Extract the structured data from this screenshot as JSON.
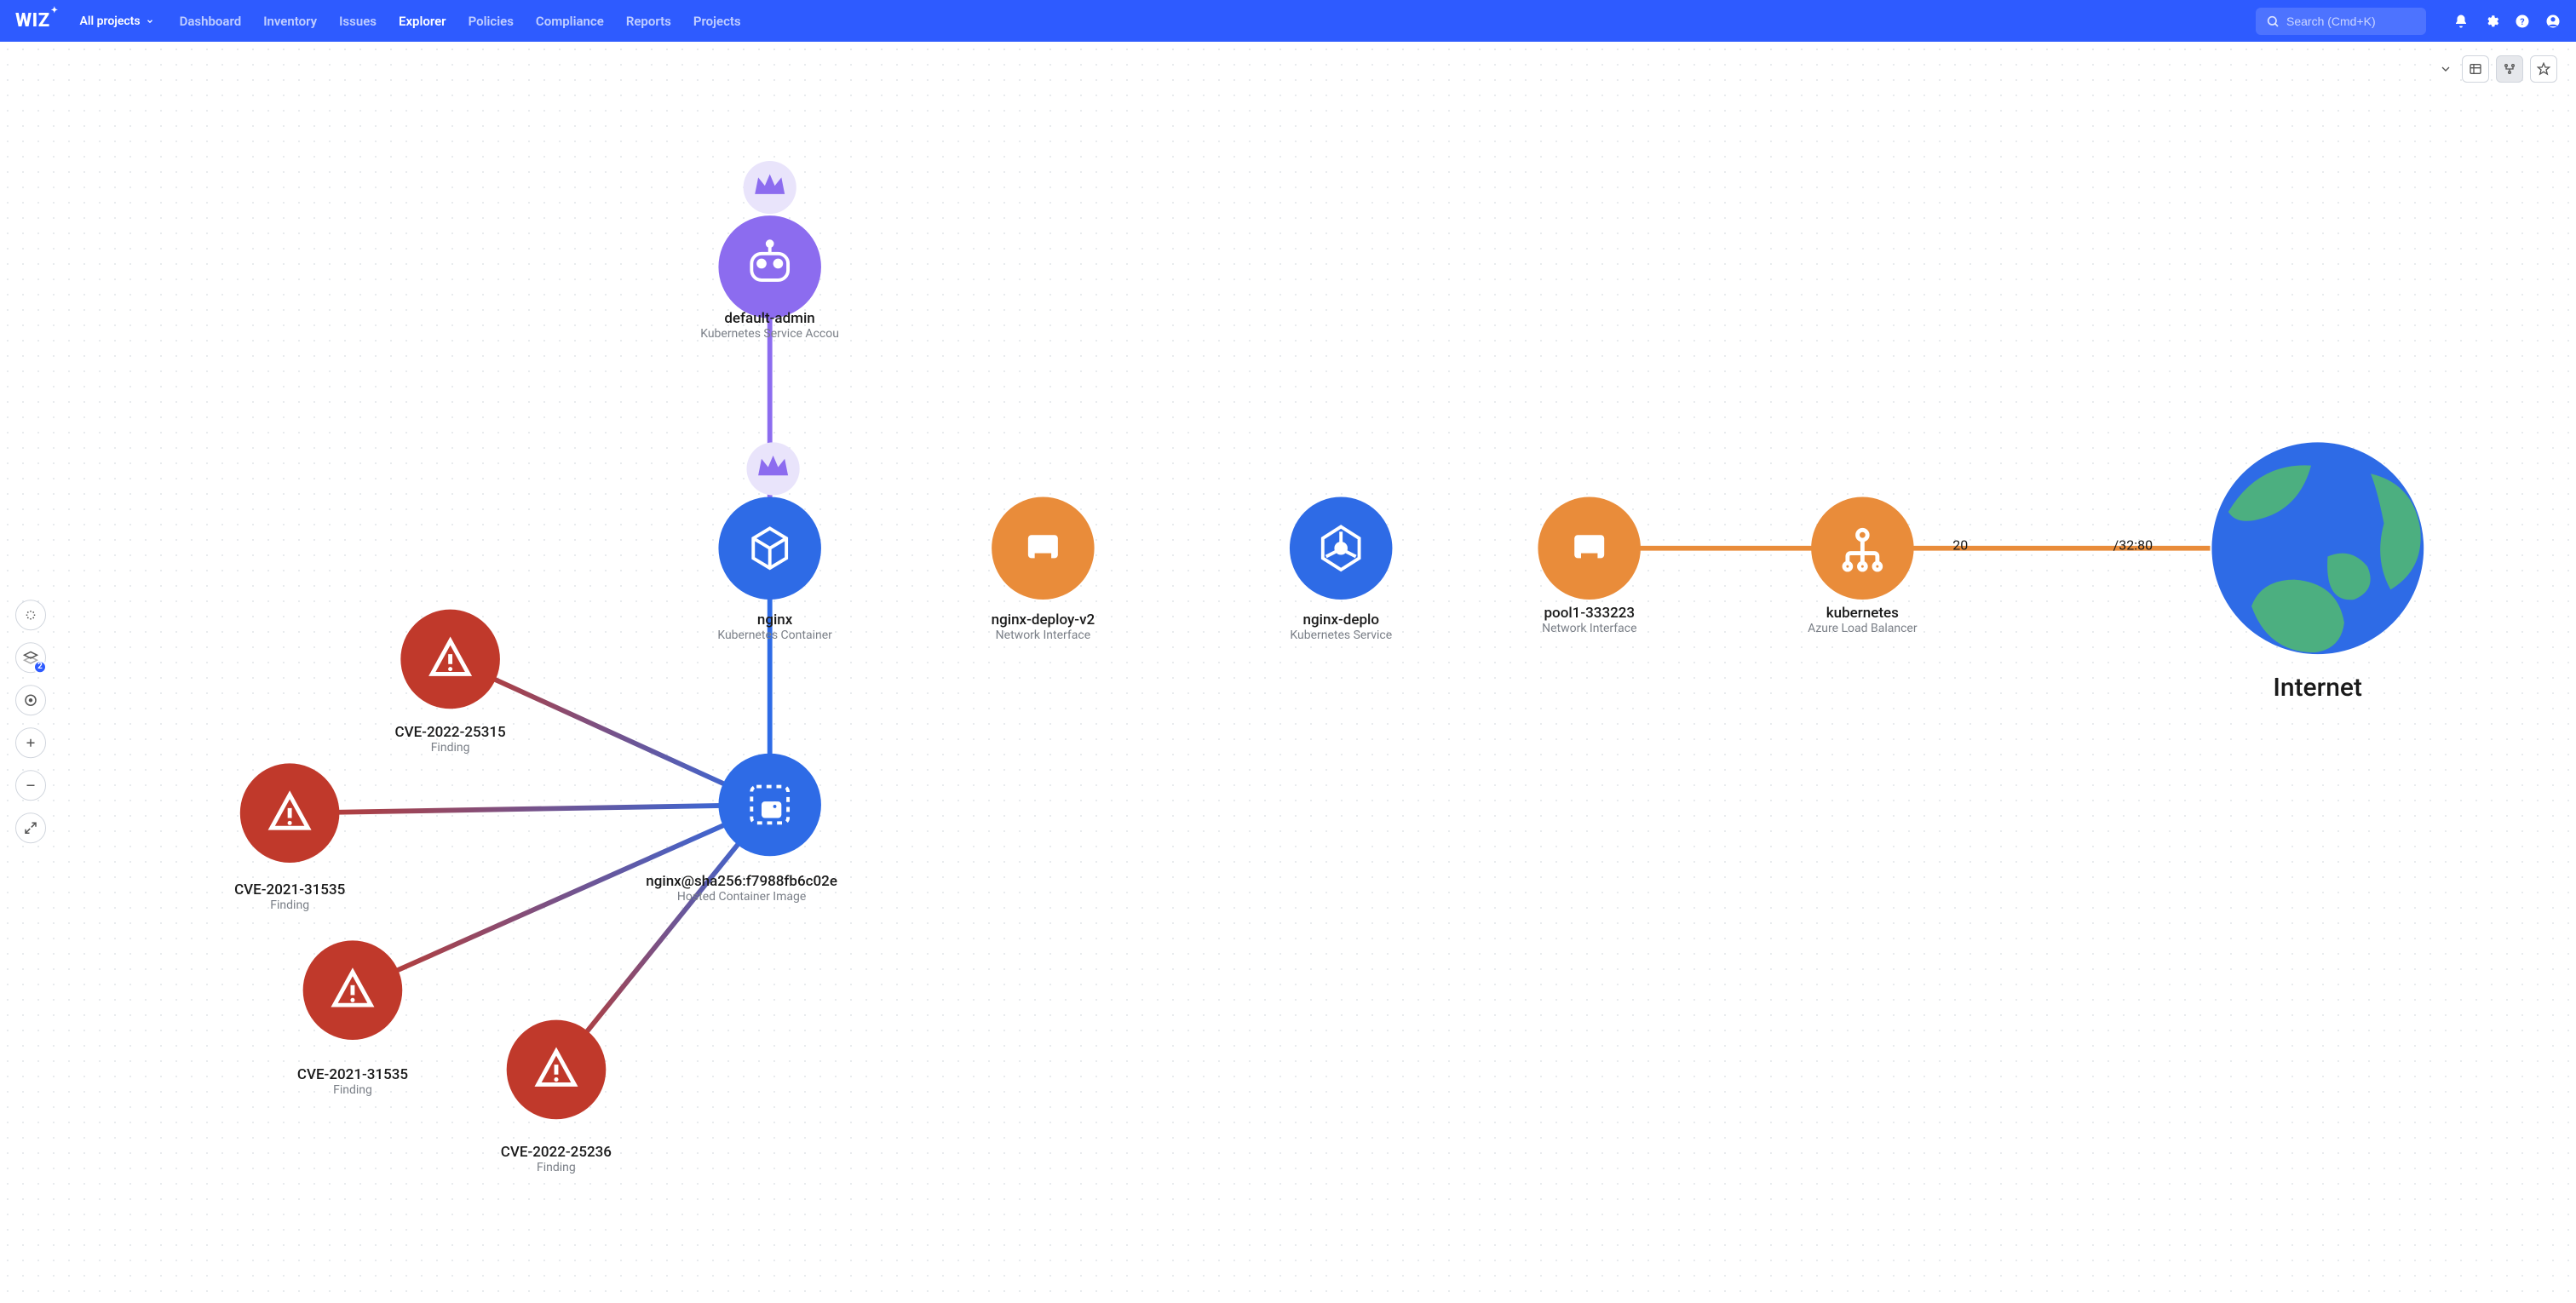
{
  "brand": "WIZ",
  "project_picker": {
    "label": "All projects"
  },
  "nav": [
    {
      "label": "Dashboard",
      "active": false
    },
    {
      "label": "Inventory",
      "active": false
    },
    {
      "label": "Issues",
      "active": false
    },
    {
      "label": "Explorer",
      "active": true
    },
    {
      "label": "Policies",
      "active": false
    },
    {
      "label": "Compliance",
      "active": false
    },
    {
      "label": "Reports",
      "active": false
    },
    {
      "label": "Projects",
      "active": false
    }
  ],
  "search": {
    "placeholder": "Search (Cmd+K)"
  },
  "left_tools": {
    "layers_badge": "2"
  },
  "colors": {
    "purple": "#8C6CEF",
    "blue": "#2E6BE6",
    "orange": "#E98C3A",
    "red": "#C0392B",
    "globe_land": "#4CAF80",
    "globe_water": "#2E6BE6"
  },
  "nodes": {
    "sa": {
      "title": "default-admin",
      "subtitle": "Kubernetes Service Accou"
    },
    "nginx": {
      "title": "nginx",
      "subtitle": "Kubernetes Container"
    },
    "netif1": {
      "title": "nginx-deploy-v2",
      "subtitle": "Network Interface"
    },
    "svc": {
      "title": "nginx-deplo",
      "subtitle": "Kubernetes Service"
    },
    "netif2": {
      "title": "pool1-333223",
      "subtitle": "Network Interface"
    },
    "lb": {
      "title": "kubernetes",
      "subtitle": "Azure Load Balancer"
    },
    "img": {
      "title": "nginx@sha256:f7988fb6c02e",
      "subtitle": "Hosted Container Image"
    },
    "cve1": {
      "title": "CVE-2022-25315",
      "subtitle": "Finding"
    },
    "cve2": {
      "title": "CVE-2021-31535",
      "subtitle": "Finding"
    },
    "cve3": {
      "title": "CVE-2021-31535",
      "subtitle": "Finding"
    },
    "cve4": {
      "title": "CVE-2022-25236",
      "subtitle": "Finding"
    },
    "internet": {
      "title": "Internet"
    }
  },
  "edge_labels": {
    "lb_internet_left": "20",
    "lb_internet_right": "/32:80"
  }
}
